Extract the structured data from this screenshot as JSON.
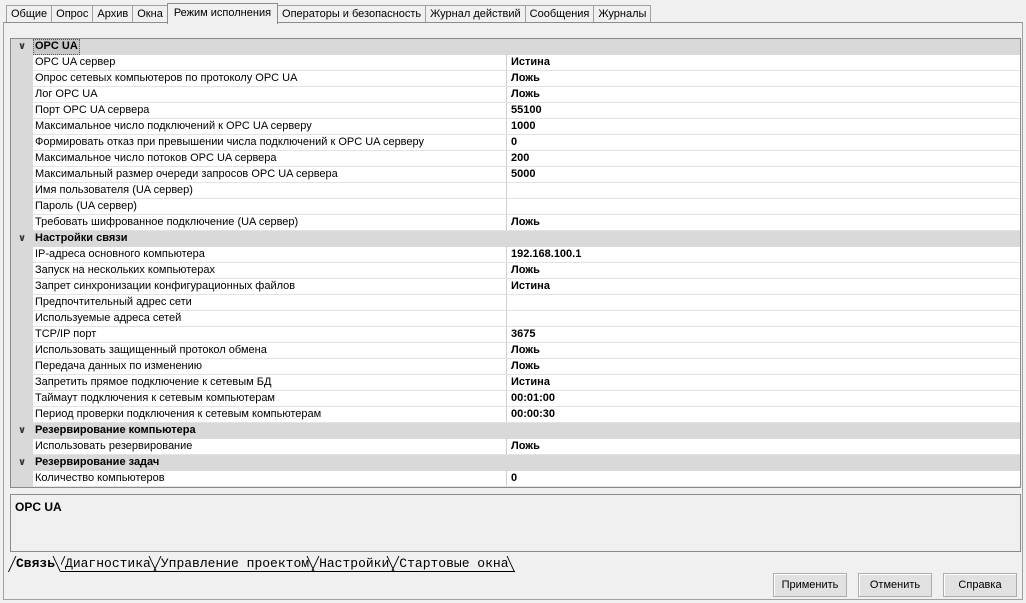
{
  "top_tabs": [
    "Общие",
    "Опрос",
    "Архив",
    "Окна",
    "Режим исполнения",
    "Операторы и безопасность",
    "Журнал действий",
    "Сообщения",
    "Журналы"
  ],
  "active_top_tab": "Режим исполнения",
  "grid": {
    "categories": [
      {
        "title": "OPC UA",
        "selected": true,
        "rows": [
          {
            "name": "OPC UA сервер",
            "value": "Истина"
          },
          {
            "name": "Опрос сетевых компьютеров по протоколу OPC UA",
            "value": "Ложь"
          },
          {
            "name": "Лог OPC UA",
            "value": "Ложь"
          },
          {
            "name": "Порт OPC UA сервера",
            "value": "55100"
          },
          {
            "name": "Максимальное число подключений к OPC UA серверу",
            "value": "1000"
          },
          {
            "name": "Формировать отказ при превышении числа подключений к OPC UA серверу",
            "value": "0"
          },
          {
            "name": "Максимальное число потоков OPC UA сервера",
            "value": "200"
          },
          {
            "name": "Максимальный размер очереди запросов OPC UA сервера",
            "value": "5000"
          },
          {
            "name": "Имя пользователя (UA сервер)",
            "value": ""
          },
          {
            "name": "Пароль (UA сервер)",
            "value": ""
          },
          {
            "name": "Требовать шифрованное подключение (UA сервер)",
            "value": "Ложь"
          }
        ]
      },
      {
        "title": "Настройки связи",
        "selected": false,
        "rows": [
          {
            "name": "IP-адреса основного компьютера",
            "value": "192.168.100.1"
          },
          {
            "name": "Запуск на нескольких компьютерах",
            "value": "Ложь"
          },
          {
            "name": "Запрет синхронизации конфигурационных файлов",
            "value": "Истина"
          },
          {
            "name": "Предпочтительный адрес сети",
            "value": ""
          },
          {
            "name": "Используемые адреса сетей",
            "value": ""
          },
          {
            "name": "TCP/IP порт",
            "value": "3675"
          },
          {
            "name": "Использовать защищенный протокол обмена",
            "value": "Ложь"
          },
          {
            "name": "Передача данных по изменению",
            "value": "Ложь"
          },
          {
            "name": "Запретить прямое подключение к сетевым БД",
            "value": "Истина"
          },
          {
            "name": "Таймаут подключения к сетевым компьютерам",
            "value": "00:01:00"
          },
          {
            "name": "Период проверки подключения к сетевым компьютерам",
            "value": "00:00:30"
          }
        ]
      },
      {
        "title": "Резервирование компьютера",
        "selected": false,
        "rows": [
          {
            "name": "Использовать резервирование",
            "value": "Ложь"
          }
        ]
      },
      {
        "title": "Резервирование задач",
        "selected": false,
        "rows": [
          {
            "name": "Количество компьютеров",
            "value": "0"
          }
        ]
      }
    ]
  },
  "description": {
    "title": "OPC UA"
  },
  "bottom_tabs": [
    "Связь",
    "Диагностика",
    "Управление проектом",
    "Настройки",
    "Стартовые окна"
  ],
  "active_bottom_tab": "Связь",
  "buttons": {
    "apply": "Применить",
    "cancel": "Отменить",
    "help": "Справка"
  },
  "icons": {
    "expander": "collapse-chevron-icon"
  }
}
